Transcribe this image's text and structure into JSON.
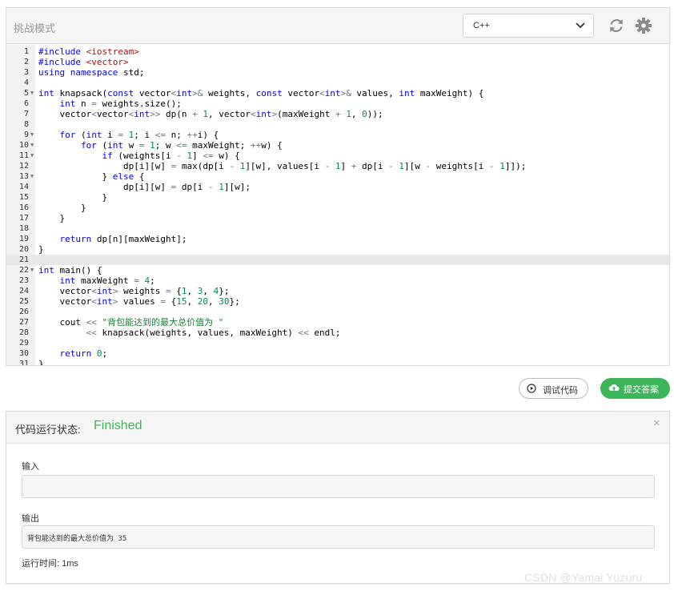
{
  "editor": {
    "mode_title": "挑战模式",
    "language": {
      "selected": "C++"
    },
    "icons": {
      "refresh": "refresh-icon",
      "settings": "gear-icon",
      "dropdown": "chevron-down-icon"
    },
    "active_line": 21,
    "lines": [
      {
        "n": "1",
        "fold": false,
        "text": "#include <iostream>"
      },
      {
        "n": "2",
        "fold": false,
        "text": "#include <vector>"
      },
      {
        "n": "3",
        "fold": false,
        "text": "using namespace std;"
      },
      {
        "n": "4",
        "fold": false,
        "text": ""
      },
      {
        "n": "5",
        "fold": true,
        "text": "int knapsack(const vector<int>& weights, const vector<int>& values, int maxWeight) {"
      },
      {
        "n": "6",
        "fold": false,
        "text": "    int n = weights.size();"
      },
      {
        "n": "7",
        "fold": false,
        "text": "    vector<vector<int>> dp(n + 1, vector<int>(maxWeight + 1, 0));"
      },
      {
        "n": "8",
        "fold": false,
        "text": ""
      },
      {
        "n": "9",
        "fold": true,
        "text": "    for (int i = 1; i <= n; ++i) {"
      },
      {
        "n": "10",
        "fold": true,
        "text": "        for (int w = 1; w <= maxWeight; ++w) {"
      },
      {
        "n": "11",
        "fold": true,
        "text": "            if (weights[i - 1] <= w) {"
      },
      {
        "n": "12",
        "fold": false,
        "text": "                dp[i][w] = max(dp[i - 1][w], values[i - 1] + dp[i - 1][w - weights[i - 1]]);"
      },
      {
        "n": "13",
        "fold": true,
        "text": "            } else {"
      },
      {
        "n": "14",
        "fold": false,
        "text": "                dp[i][w] = dp[i - 1][w];"
      },
      {
        "n": "15",
        "fold": false,
        "text": "            }"
      },
      {
        "n": "16",
        "fold": false,
        "text": "        }"
      },
      {
        "n": "17",
        "fold": false,
        "text": "    }"
      },
      {
        "n": "18",
        "fold": false,
        "text": ""
      },
      {
        "n": "19",
        "fold": false,
        "text": "    return dp[n][maxWeight];"
      },
      {
        "n": "20",
        "fold": false,
        "text": "}"
      },
      {
        "n": "21",
        "fold": false,
        "text": ""
      },
      {
        "n": "22",
        "fold": true,
        "text": "int main() {"
      },
      {
        "n": "23",
        "fold": false,
        "text": "    int maxWeight = 4;"
      },
      {
        "n": "24",
        "fold": false,
        "text": "    vector<int> weights = {1, 3, 4};"
      },
      {
        "n": "25",
        "fold": false,
        "text": "    vector<int> values = {15, 20, 30};"
      },
      {
        "n": "26",
        "fold": false,
        "text": ""
      },
      {
        "n": "27",
        "fold": false,
        "text": "    cout << \"背包能达到的最大总价值为 \""
      },
      {
        "n": "28",
        "fold": false,
        "text": "         << knapsack(weights, values, maxWeight) << endl;"
      },
      {
        "n": "29",
        "fold": false,
        "text": ""
      },
      {
        "n": "30",
        "fold": false,
        "text": "    return 0;"
      },
      {
        "n": "31",
        "fold": false,
        "text": "}"
      }
    ]
  },
  "actions": {
    "debug_label": "调试代码",
    "submit_label": "提交答案",
    "debug_icon": "play-circle-icon",
    "submit_icon": "cloud-upload-icon"
  },
  "result": {
    "status_label": "代码运行状态:",
    "status_value": "Finished",
    "status_color": "#3cb55a",
    "close_symbol": "×",
    "input_label": "输入",
    "input_value": "",
    "output_label": "输出",
    "output_value": "背包能达到的最大总价值为 35",
    "runtime": "运行时间:  1ms"
  },
  "watermark": "CSDN @Yamai Yuzuru"
}
